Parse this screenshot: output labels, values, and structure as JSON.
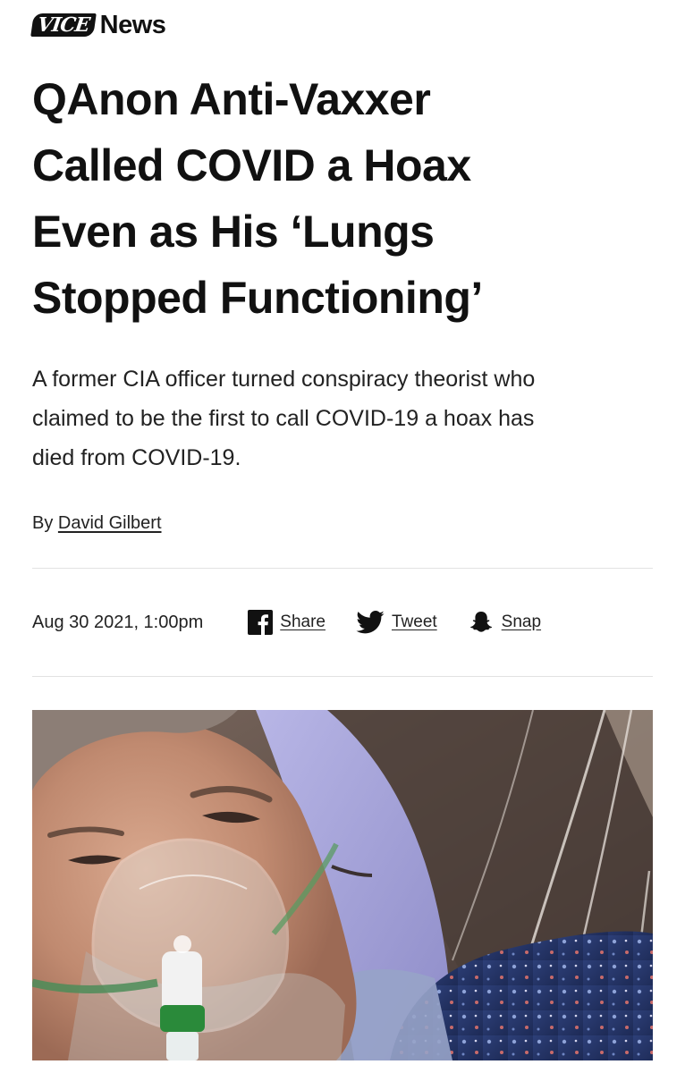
{
  "brand": {
    "logo_text": "VICE",
    "section": "News"
  },
  "article": {
    "headline_lines": [
      "QAnon Anti-Vaxxer",
      "Called COVID a Hoax",
      "Even as His ‘Lungs",
      "Stopped Functioning’"
    ],
    "dek_lines": [
      "A former CIA officer turned conspiracy theorist who",
      "claimed to be the first to call COVID-19 a hoax has",
      "died from COVID-19."
    ],
    "byline_prefix": "By",
    "author": "David Gilbert",
    "date": "Aug 30 2021, 1:00pm"
  },
  "share": {
    "facebook_label": "Share",
    "twitter_label": "Tweet",
    "snapchat_label": "Snap"
  },
  "icons": {
    "facebook": "facebook-icon",
    "twitter": "twitter-bird-icon",
    "snapchat": "snapchat-ghost-icon"
  },
  "image": {
    "description_tag": "hospital-selfie-photo"
  },
  "colors": {
    "text": "#111111",
    "divider": "#e2e2e2",
    "background": "#ffffff"
  }
}
